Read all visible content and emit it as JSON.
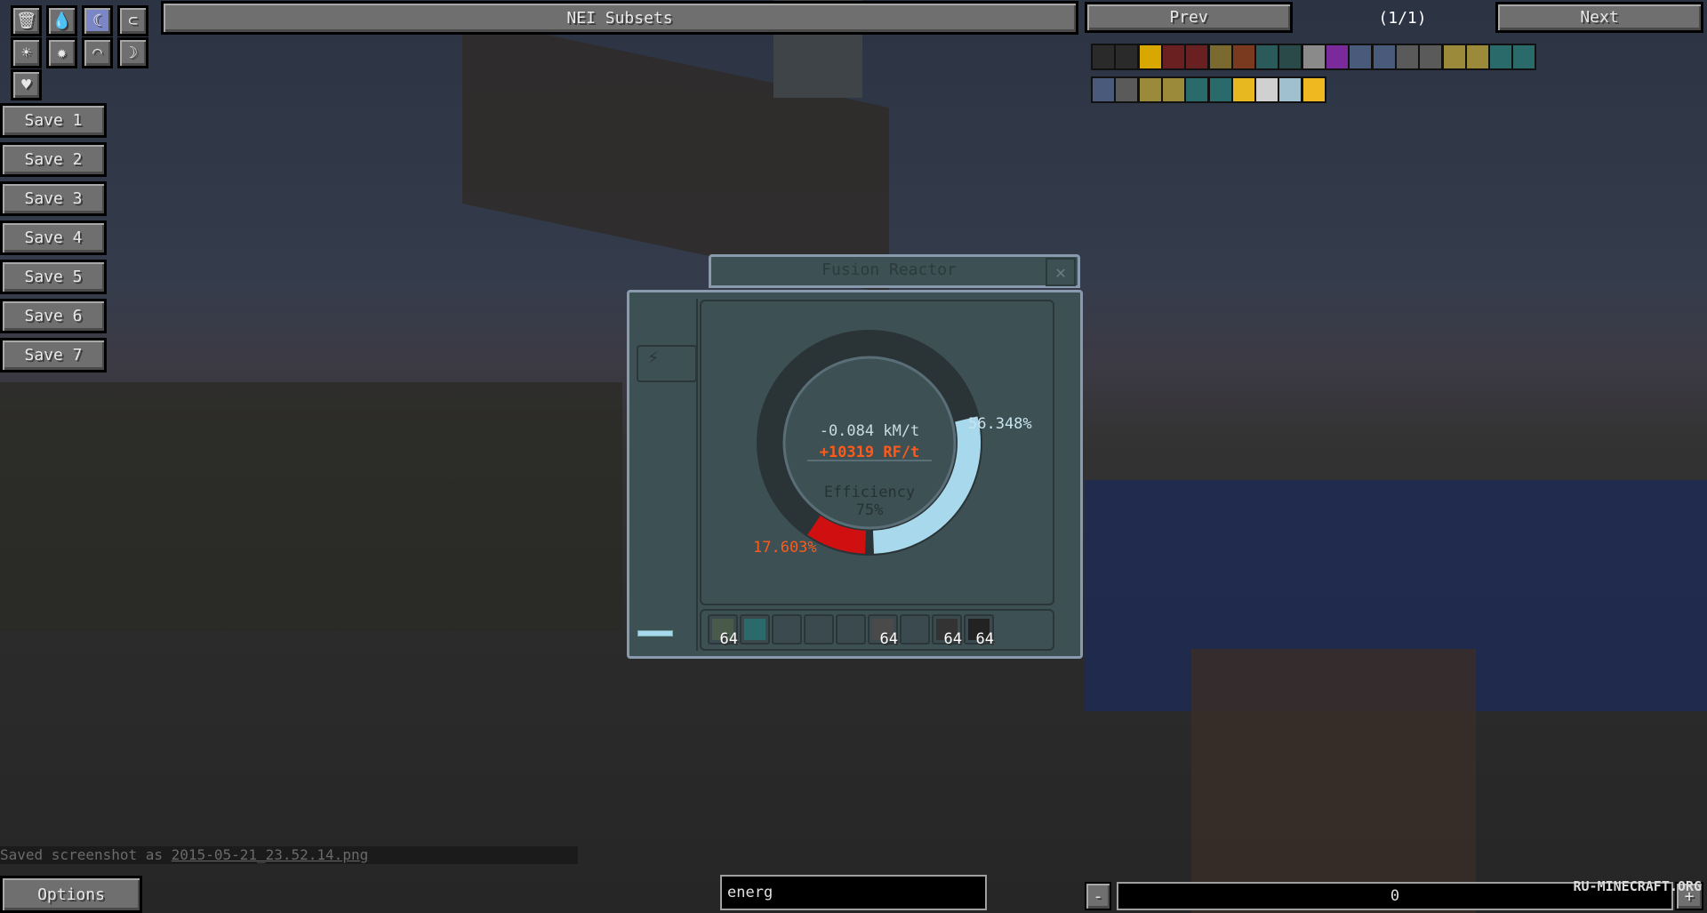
{
  "toolbar": {
    "tools": [
      {
        "icon": "trash-icon",
        "glyph": "🗑"
      },
      {
        "icon": "water-drop-icon",
        "glyph": "💧"
      },
      {
        "icon": "creative-mode-icon",
        "glyph": "☾",
        "active": true
      },
      {
        "icon": "magnet-icon",
        "glyph": "⊂"
      },
      {
        "icon": "sunrise-icon",
        "glyph": "☀"
      },
      {
        "icon": "sun-icon",
        "glyph": "✹"
      },
      {
        "icon": "moonrise-icon",
        "glyph": "◠"
      },
      {
        "icon": "moon-icon",
        "glyph": "☽"
      },
      {
        "icon": "heart-icon",
        "glyph": "♥"
      }
    ]
  },
  "saves": [
    "Save 1",
    "Save 2",
    "Save 3",
    "Save 4",
    "Save 5",
    "Save 6",
    "Save 7"
  ],
  "subsets": {
    "label": "NEI Subsets"
  },
  "paging": {
    "prev": "Prev",
    "page": "(1/1)",
    "next": "Next"
  },
  "items": {
    "row1": [
      "#2a2a2a",
      "#2a2a2a",
      "#d8a800",
      "#6a2020",
      "#6a2020",
      "#7a6a30",
      "#7a3a20",
      "#2a5a5a",
      "#2a4a4a",
      "#8a8a8a",
      "#7a2a9a",
      "#4a5a7a",
      "#4a5a7a",
      "#5a5a5a",
      "#5a5a5a",
      "#9a8a3a",
      "#9a8a3a",
      "#2a6a6a",
      "#2a6a6a"
    ],
    "row2": [
      "#4a5a7a",
      "#5a5a5a",
      "#9a8a3a",
      "#9a8a3a",
      "#2a6a6a",
      "#2a6a6a",
      "#e8b820",
      "#d0d0d0",
      "#a0c0d0",
      "#f0b820"
    ]
  },
  "reactor": {
    "title": "Fusion Reactor",
    "close": "✕",
    "rate": "-0.084 kM/t",
    "rf": "+10319 RF/t",
    "efficiency_label": "Efficiency",
    "efficiency": "75%",
    "hot_label": "17.603%",
    "hot_value": 17.603,
    "cold_label": "56.348%",
    "cold_value": 56.348,
    "hot_color": "#d01010",
    "cold_color": "#a8d8ec",
    "rf_color": "#ff5a1a",
    "slots": [
      {
        "count": "64",
        "color": "#4a5a4a"
      },
      {
        "count": "",
        "color": "#2a6a6a"
      },
      {
        "count": ""
      },
      {
        "count": ""
      },
      {
        "count": ""
      },
      {
        "count": "64",
        "color": "#4a4a4a"
      },
      {
        "count": ""
      },
      {
        "count": "64",
        "color": "#333"
      },
      {
        "count": "64",
        "color": "#222"
      }
    ]
  },
  "chat": {
    "prefix": "Saved screenshot as ",
    "file": "2015-05-21_23.52.14.png"
  },
  "options": "Options",
  "search": {
    "value": "energ"
  },
  "quantity": {
    "minus": "-",
    "value": "0",
    "plus": "+"
  },
  "watermark": "RU-MINECRAFT.ORG"
}
